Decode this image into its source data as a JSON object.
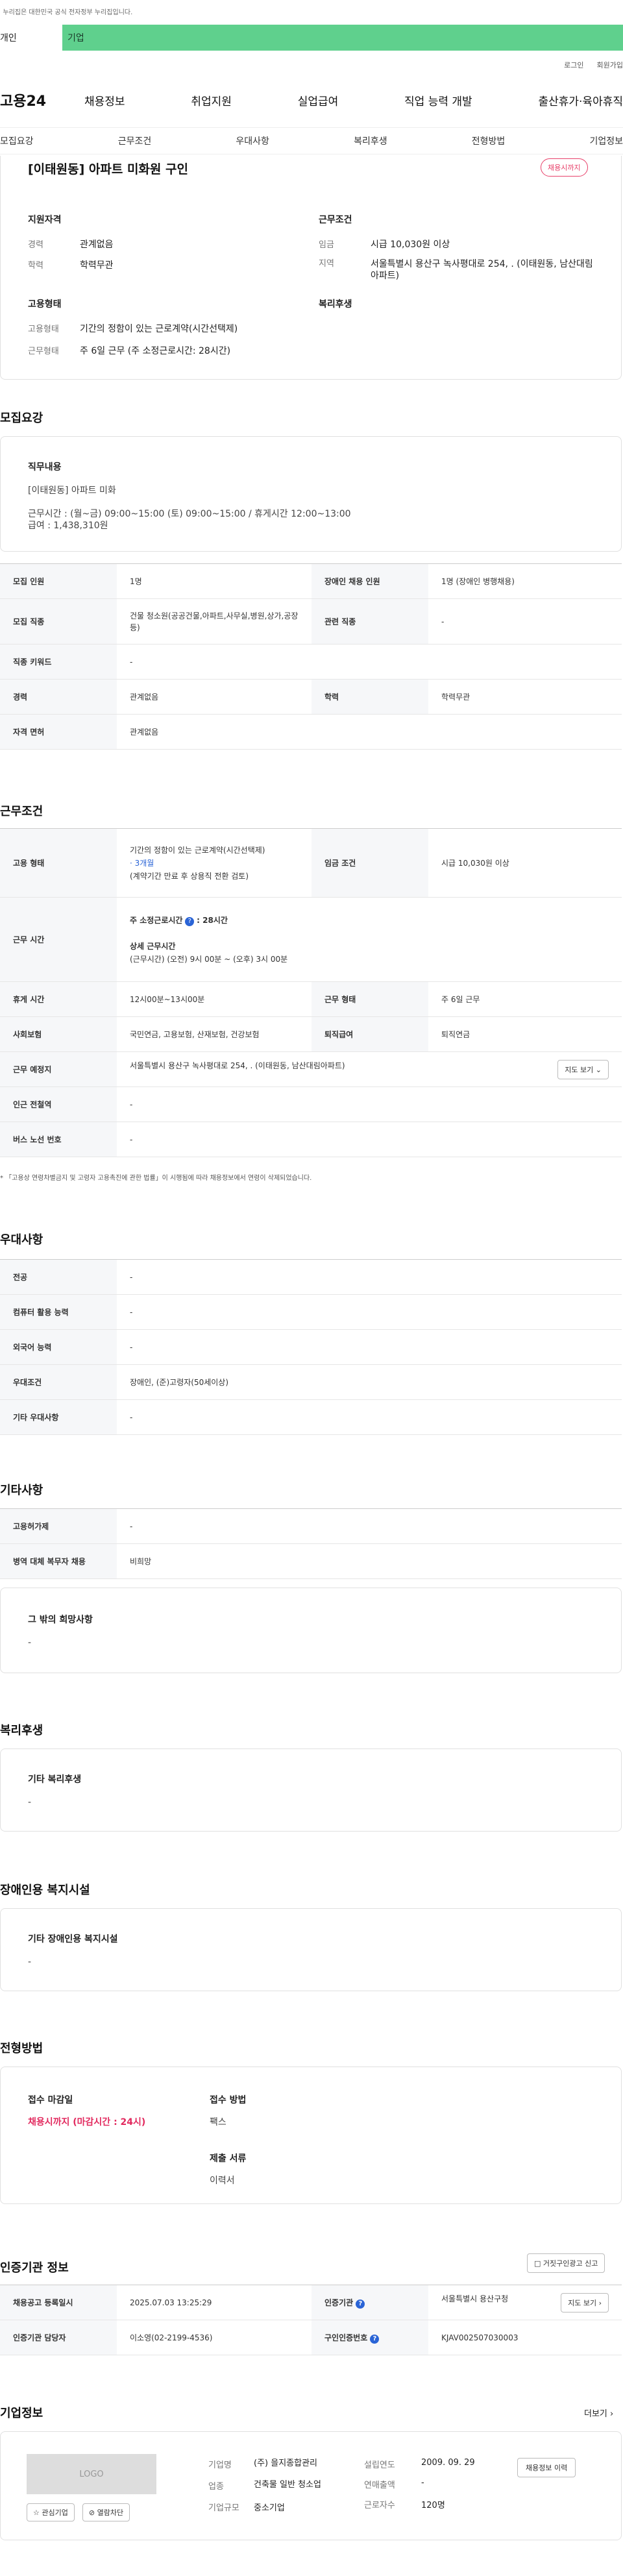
{
  "top": {
    "notice": "이 누리집은 대한민국 공식 전자정부 누리집입니다.",
    "tab_personal": "개인",
    "tab_company": "기업",
    "login": "로그인",
    "join": "회원가입"
  },
  "gnb": {
    "logo": "고용24",
    "menu": [
      "채용정보",
      "취업지원",
      "실업급여",
      "직업 능력 개발",
      "출산휴가·육아휴직"
    ]
  },
  "subnav": [
    "모집요강",
    "근무조건",
    "우대사항",
    "복리후생",
    "전형방법",
    "기업정보"
  ],
  "summary": {
    "title": "[이태원동] 아파트 미화원 구인",
    "badge": "채용시까지",
    "qual_title": "지원자격",
    "qual": [
      {
        "k": "경력",
        "v": "관계없음"
      },
      {
        "k": "학력",
        "v": "학력무관"
      }
    ],
    "cond_title": "근무조건",
    "cond": [
      {
        "k": "임금",
        "v": "시급 10,030원 이상"
      },
      {
        "k": "지역",
        "v": "서울특별시 용산구 녹사평대로 254, . (이태원동, 남산대림아파트)"
      }
    ],
    "emp_title": "고용형태",
    "emp": [
      {
        "k": "고용형태",
        "v": "기간의 정함이 있는 근로계약(시간선택제)"
      },
      {
        "k": "근무형태",
        "v": "주 6일 근무 (주 소정근로시간: 28시간)"
      }
    ],
    "welfare_title": "복리후생"
  },
  "recruit": {
    "title": "모집요강",
    "job_title": "직무내용",
    "job_lines": [
      "[이태원동] 아파트 미화",
      "",
      "근무시간 : (월~금) 09:00~15:00 (토) 09:00~15:00 / 휴게시간 12:00~13:00",
      "급여 : 1,438,310원"
    ],
    "rows": [
      [
        "모집 인원",
        "1명",
        "장애인 채용 인원",
        "1명 (장애인 병행채용)"
      ],
      [
        "모집 직종",
        "건물 청소원(공공건물,아파트,사무실,병원,상가,공장 등)",
        "관련 직종",
        "-"
      ],
      [
        "직종 키워드",
        "-"
      ],
      [
        "경력",
        "관계없음",
        "학력",
        "학력무관"
      ],
      [
        "자격 면허",
        "관계없음"
      ]
    ]
  },
  "work": {
    "title": "근무조건",
    "emp_type_k": "고용 형태",
    "emp_type_v1": "기간의 정함이 있는 근로계약(시간선택제)",
    "emp_type_v2": "· 3개월",
    "emp_type_v3": "(계약기간 만료 후 상용직 전환 검토)",
    "wage_k": "임금 조건",
    "wage_v": "시급 10,030원 이상",
    "hours_k": "근무 시간",
    "hours_l1": "주 소정근로시간",
    "hours_l1b": ": 28시간",
    "hours_l2": "상세 근무시간",
    "hours_l3": "(근무시간) (오전) 9시 00분 ~ (오후) 3시 00분",
    "rows": [
      [
        "휴게 시간",
        "12시00분~13시00분",
        "근무 형태",
        "주 6일 근무"
      ],
      [
        "사회보험",
        "국민연금, 고용보험, 산재보험, 건강보험",
        "퇴직급여",
        "퇴직연금"
      ]
    ],
    "place_k": "근무 예정지",
    "place_v": "서울특별시 용산구 녹사평대로 254, . (이태원동, 남산대림아파트)",
    "map_btn": "지도 보기",
    "station_k": "인근 전철역",
    "station_v": "-",
    "bus_k": "버스 노선 번호",
    "bus_v": "-",
    "note": "* 「고용상 연령차별금지 및 고령자 고용촉진에 관한 법률」이 시행됨에 따라 채용정보에서 연령이 삭제되었습니다."
  },
  "pref": {
    "title": "우대사항",
    "rows": [
      [
        "전공",
        "-"
      ],
      [
        "컴퓨터 활용 능력",
        "-"
      ],
      [
        "외국어 능력",
        "-"
      ],
      [
        "우대조건",
        "장애인, (준)고령자(50세이상)"
      ],
      [
        "기타 우대사항",
        "-"
      ]
    ]
  },
  "etc": {
    "title": "기타사항",
    "rows": [
      [
        "고용허가제",
        "-"
      ],
      [
        "병역 대체 복무자 채용",
        "비희망"
      ]
    ],
    "other_title": "그 밖의 희망사항",
    "other_v": "-"
  },
  "welfare": {
    "title": "복리후생",
    "box_title": "기타 복리후생",
    "box_v": "-"
  },
  "disab": {
    "title": "장애인용 복지시설",
    "box_title": "기타 장애인용 복지시설",
    "box_v": "-"
  },
  "process": {
    "title": "전형방법",
    "deadline_k": "접수 마감일",
    "deadline_v": "채용시까지 (마감시간 : 24시)",
    "method_k": "접수 방법",
    "method_v": "팩스",
    "docs_k": "제출 서류",
    "docs_v": "이력서"
  },
  "cert": {
    "title": "인증기관 정보",
    "report_btn": "거짓구인광고 신고",
    "reg_k": "채용공고 등록일시",
    "reg_v": "2025.07.03 13:25:29",
    "org_k": "인증기관",
    "org_v": "서울특별시 용산구청",
    "map_btn": "지도 보기",
    "mgr_k": "인증기관 담당자",
    "mgr_v": "이소영(02-2199-4536)",
    "num_k": "구인인증번호",
    "num_v": "KJAV002507030003"
  },
  "company": {
    "title": "기업정보",
    "more": "더보기",
    "logo": "LOGO",
    "fav_btn": "관심기업",
    "block_btn": "열람차단",
    "name_k": "기업명",
    "name_v": "(주) 을지종합관리",
    "industry_k": "업종",
    "industry_v": "건축물 일반 청소업",
    "size_k": "기업규모",
    "size_v": "중소기업",
    "year_k": "설립연도",
    "year_v": "2009. 09. 29",
    "sales_k": "연매출액",
    "sales_v": "-",
    "staff_k": "근로자수",
    "staff_v": "120명",
    "history_btn": "채용정보 이력"
  }
}
